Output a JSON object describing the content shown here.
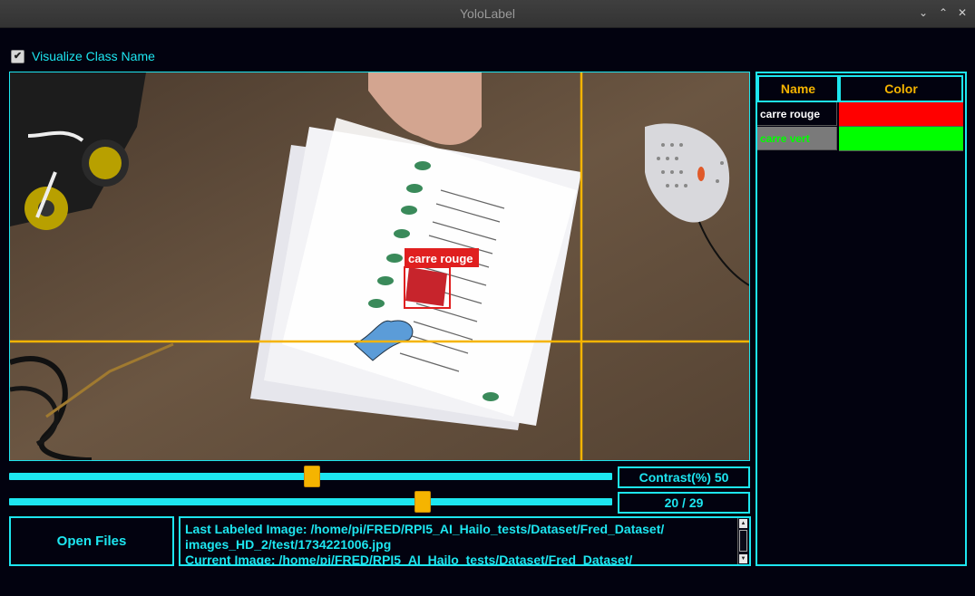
{
  "window": {
    "title": "YoloLabel",
    "buttons": [
      "chevron-down",
      "chevron-up",
      "close"
    ],
    "glyphs": [
      "⌄",
      "⌃",
      "✕"
    ]
  },
  "options": {
    "visualize_class_name_label": "Visualize Class Name",
    "visualize_class_name_checked": true,
    "check_glyph": "✔"
  },
  "canvas": {
    "box_label": "carre rouge",
    "box_color": "#e01f1f",
    "crosshair_color": "#f5b400"
  },
  "contrast": {
    "label": "Contrast(%) 50",
    "value_percent": 50
  },
  "image_nav": {
    "label": "20 / 29",
    "current": 20,
    "total": 29
  },
  "open_button": {
    "label": "Open Files"
  },
  "log": {
    "text": "Last Labeled Image: /home/pi/FRED/RPI5_AI_Hailo_tests/Dataset/Fred_Dataset/\nimages_HD_2/test/1734221006.jpg\nCurrent Image: /home/pi/FRED/RPI5_AI_Hailo_tests/Dataset/Fred_Dataset/"
  },
  "class_table": {
    "headers": {
      "name": "Name",
      "color": "Color"
    },
    "rows": [
      {
        "name": "carre rouge",
        "color": "#ff0000",
        "selected": false,
        "text_color": "#ffffff"
      },
      {
        "name": "carre vert",
        "color": "#00ff00",
        "selected": true,
        "text_color": "#00ff00"
      }
    ]
  },
  "colors": {
    "accent": "#1de6f0",
    "highlight": "#f5b400",
    "background": "#02020f"
  }
}
